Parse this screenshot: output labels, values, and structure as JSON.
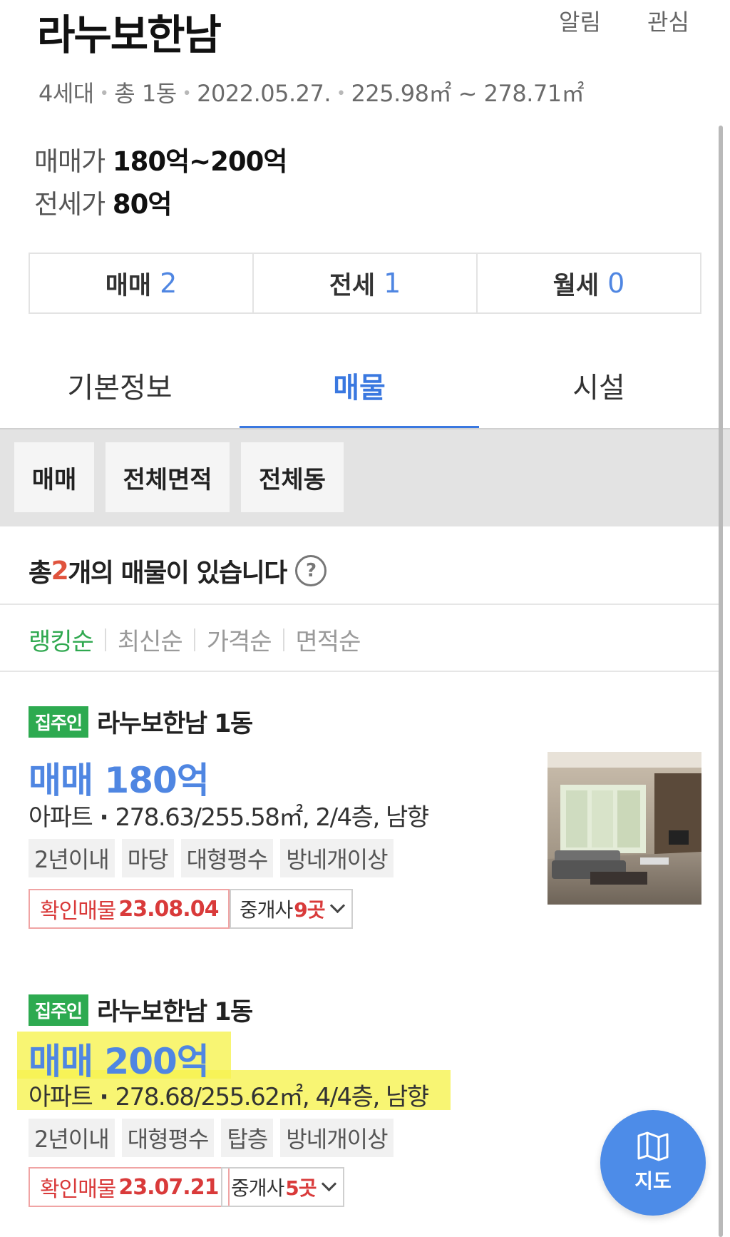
{
  "header": {
    "title": "라누보한남",
    "alarm_label": "알림",
    "favorite_label": "관심"
  },
  "meta": {
    "households": "4세대",
    "buildings": "총 1동",
    "date": "2022.05.27.",
    "area_range": "225.98㎡ ~ 278.71㎡"
  },
  "prices": {
    "sale_label": "매매가",
    "sale_value": "180억~200억",
    "jeonse_label": "전세가",
    "jeonse_value": "80억"
  },
  "counts": [
    {
      "label": "매매",
      "value": "2"
    },
    {
      "label": "전세",
      "value": "1"
    },
    {
      "label": "월세",
      "value": "0"
    }
  ],
  "tabs": [
    {
      "label": "기본정보",
      "active": false
    },
    {
      "label": "매물",
      "active": true
    },
    {
      "label": "시설",
      "active": false
    }
  ],
  "filters": [
    "매매",
    "전체면적",
    "전체동"
  ],
  "summary": {
    "prefix": "총 ",
    "count": "2",
    "suffix": "개의 매물이 있습니다",
    "help_icon": "question-circle-icon"
  },
  "sort": {
    "options": [
      "랭킹순",
      "최신순",
      "가격순",
      "면적순"
    ],
    "active": "랭킹순"
  },
  "listings": [
    {
      "badge": "집주인",
      "building": "라누보한남 1동",
      "deal": "매매 180억",
      "type": "아파트",
      "spec": "278.63/255.58㎡, 2/4층, 남향",
      "tags": [
        "2년이내",
        "마당",
        "대형평수",
        "방네개이상"
      ],
      "confirm_label": "확인매물",
      "confirm_date": "23.08.04",
      "agents_prefix": "중개사",
      "agents_count": "9곳",
      "has_photo": true
    },
    {
      "badge": "집주인",
      "building": "라누보한남 1동",
      "deal": "매매 200억",
      "type": "아파트",
      "spec": "278.68/255.62㎡, 4/4층, 남향",
      "tags": [
        "2년이내",
        "대형평수",
        "탑층",
        "방네개이상"
      ],
      "confirm_label": "확인매물",
      "confirm_date": "23.07.21",
      "agents_prefix": "중개사",
      "agents_count": "5곳",
      "has_photo": false
    }
  ],
  "fab": {
    "label": "지도",
    "icon": "map-icon"
  },
  "colors": {
    "accent_blue": "#3a78e0",
    "owner_green": "#2daa50",
    "confirm_red": "#d93a3a",
    "highlight_yellow": "#f6f250"
  }
}
